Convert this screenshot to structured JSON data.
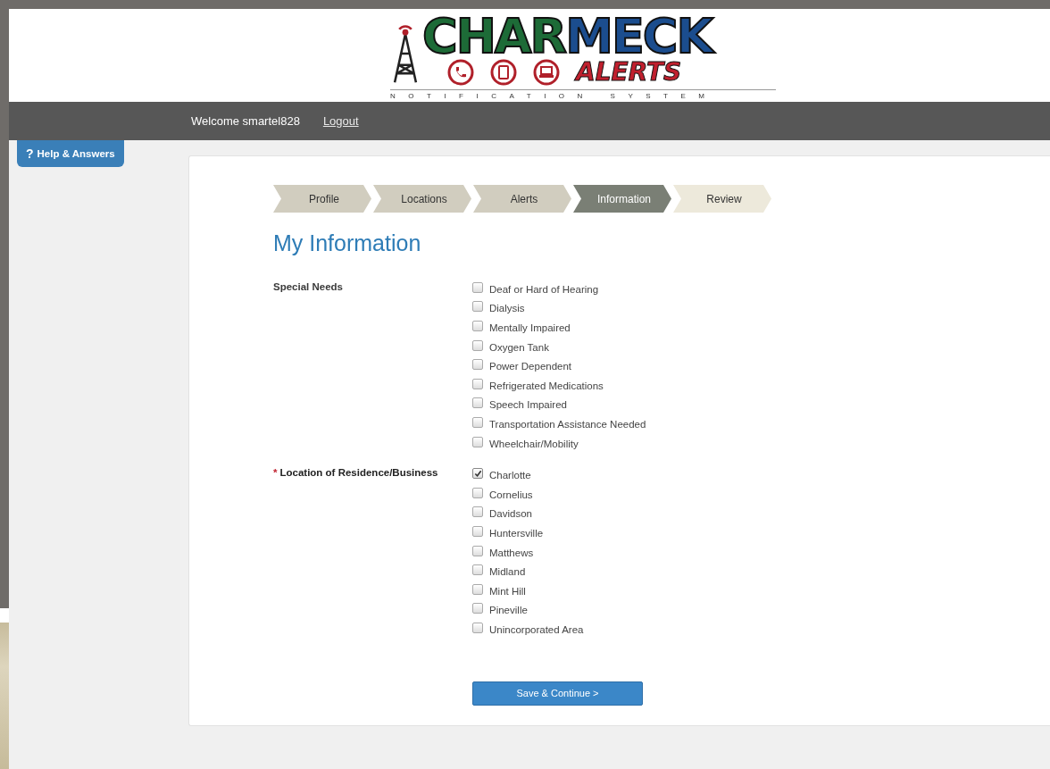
{
  "logo": {
    "word_1": "CHAR",
    "word_2": "MECK",
    "word_3": "ALERTS",
    "tagline": "NOTIFICATION SYSTEM"
  },
  "header": {
    "welcome": "Welcome smartel828",
    "logout": "Logout"
  },
  "help_tab": {
    "icon_glyph": "?",
    "label": "Help & Answers"
  },
  "steps": [
    {
      "label": "Profile",
      "selected": false,
      "completed": true
    },
    {
      "label": "Locations",
      "selected": false,
      "completed": true
    },
    {
      "label": "Alerts",
      "selected": false,
      "completed": true
    },
    {
      "label": "Information",
      "selected": true,
      "completed": false
    },
    {
      "label": "Review",
      "selected": false,
      "completed": false
    }
  ],
  "title": "My Information",
  "groups": [
    {
      "label": "Special Needs",
      "required": false,
      "options": [
        {
          "label": "Deaf or Hard of Hearing",
          "checked": false
        },
        {
          "label": "Dialysis",
          "checked": false
        },
        {
          "label": "Mentally Impaired",
          "checked": false
        },
        {
          "label": "Oxygen Tank",
          "checked": false
        },
        {
          "label": "Power Dependent",
          "checked": false
        },
        {
          "label": "Refrigerated Medications",
          "checked": false
        },
        {
          "label": "Speech Impaired",
          "checked": false
        },
        {
          "label": "Transportation Assistance Needed",
          "checked": false
        },
        {
          "label": "Wheelchair/Mobility",
          "checked": false
        }
      ]
    },
    {
      "label": "Location of Residence/Business",
      "required": true,
      "required_mark": "*",
      "options": [
        {
          "label": "Charlotte",
          "checked": true
        },
        {
          "label": "Cornelius",
          "checked": false
        },
        {
          "label": "Davidson",
          "checked": false
        },
        {
          "label": "Huntersville",
          "checked": false
        },
        {
          "label": "Matthews",
          "checked": false
        },
        {
          "label": "Midland",
          "checked": false
        },
        {
          "label": "Mint Hill",
          "checked": false
        },
        {
          "label": "Pineville",
          "checked": false
        },
        {
          "label": "Unincorporated Area",
          "checked": false
        }
      ]
    }
  ],
  "submit": "Save & Continue >"
}
